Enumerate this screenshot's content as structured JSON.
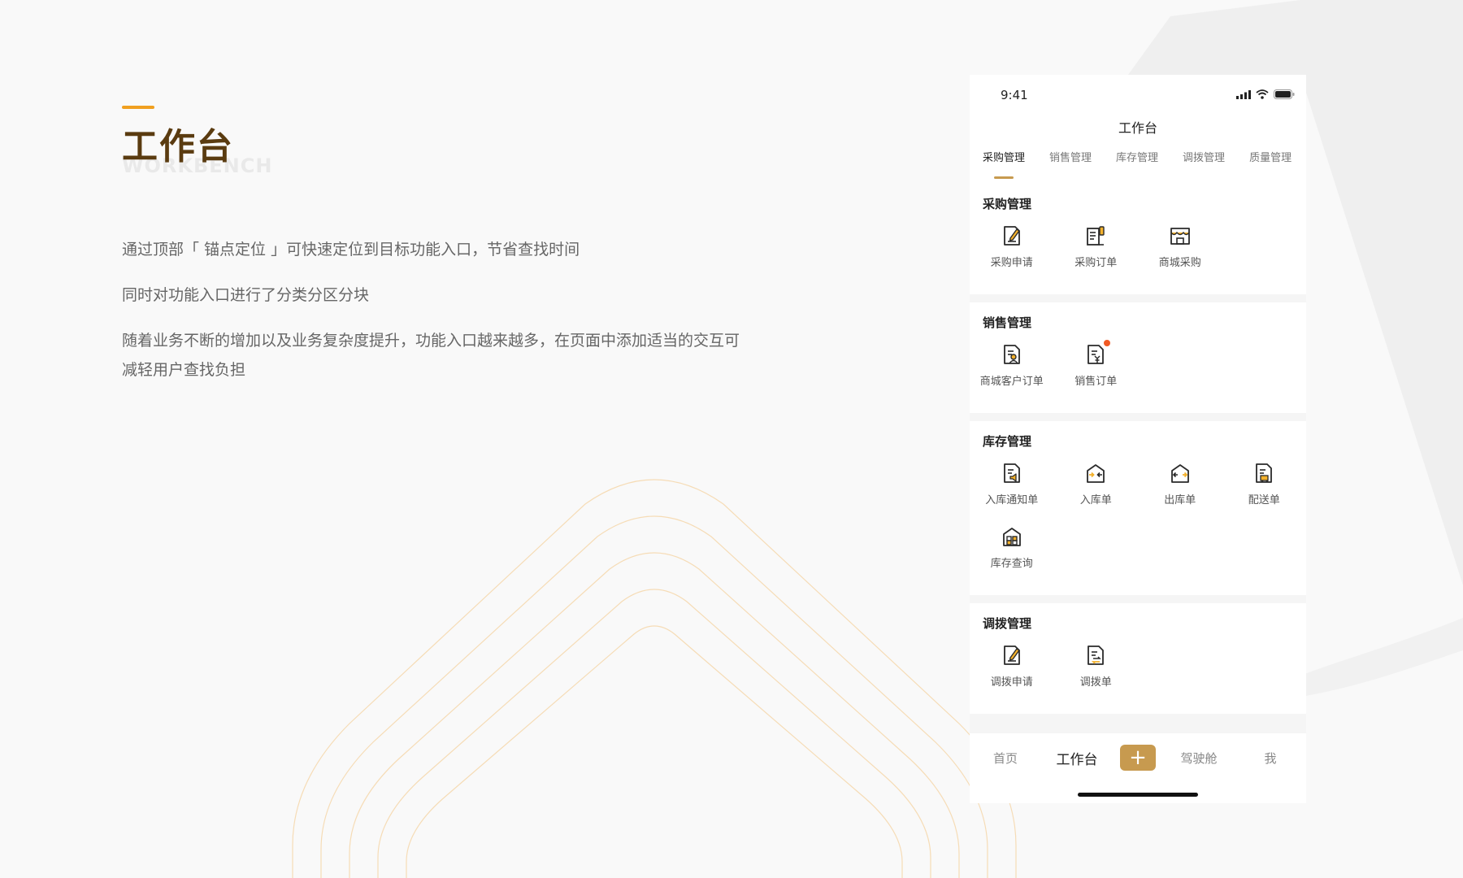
{
  "colors": {
    "accent": "#f0a020",
    "brand": "#c79a4f",
    "heading": "#5a3b10",
    "badge": "#f15a24",
    "icon_stroke": "#2a2a2a",
    "icon_fill": "#f3b12c"
  },
  "hero": {
    "title": "工作台",
    "subtitle": "WORKBENCH"
  },
  "description": [
    "通过顶部「 锚点定位 」可快速定位到目标功能入口，节省查找时间",
    "同时对功能入口进行了分类分区分块",
    "随着业务不断的增加以及业务复杂度提升，功能入口越来越多，在页面中添加适当的交互可减轻用户查找负担"
  ],
  "phone": {
    "status_time": "9:41",
    "nav_title": "工作台",
    "tabs": [
      {
        "label": "采购管理",
        "active": true
      },
      {
        "label": "销售管理",
        "active": false
      },
      {
        "label": "库存管理",
        "active": false
      },
      {
        "label": "调拨管理",
        "active": false
      },
      {
        "label": "质量管理",
        "active": false
      }
    ],
    "sections": [
      {
        "title": "采购管理",
        "items": [
          {
            "label": "采购申请",
            "icon": "pencil-doc-icon"
          },
          {
            "label": "采购订单",
            "icon": "order-doc-icon"
          },
          {
            "label": "商城采购",
            "icon": "store-icon"
          }
        ]
      },
      {
        "title": "销售管理",
        "items": [
          {
            "label": "商城客户订单",
            "icon": "customer-doc-icon"
          },
          {
            "label": "销售订单",
            "icon": "yen-doc-icon",
            "badge": true
          }
        ]
      },
      {
        "title": "库存管理",
        "items": [
          {
            "label": "入库通知单",
            "icon": "notice-doc-icon"
          },
          {
            "label": "入库单",
            "icon": "warehouse-in-icon"
          },
          {
            "label": "出库单",
            "icon": "warehouse-out-icon"
          },
          {
            "label": "配送单",
            "icon": "delivery-doc-icon"
          },
          {
            "label": "库存查询",
            "icon": "inventory-icon"
          }
        ]
      },
      {
        "title": "调拨管理",
        "items": [
          {
            "label": "调拨申请",
            "icon": "pencil-doc-icon"
          },
          {
            "label": "调拨单",
            "icon": "transfer-doc-icon"
          }
        ]
      }
    ],
    "bottom_nav": {
      "home": "首页",
      "workbench": "工作台",
      "plus": "+",
      "cockpit": "驾驶舱",
      "me": "我"
    }
  }
}
